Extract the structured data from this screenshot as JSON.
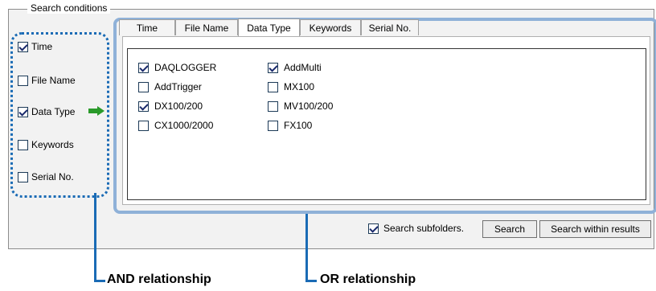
{
  "group": {
    "legend": "Search conditions"
  },
  "left_conditions": [
    {
      "label": "Time",
      "checked": true
    },
    {
      "label": "File Name",
      "checked": false
    },
    {
      "label": "Data Type",
      "checked": true
    },
    {
      "label": "Keywords",
      "checked": false
    },
    {
      "label": "Serial No.",
      "checked": false
    }
  ],
  "tabs": [
    {
      "label": "Time",
      "active": false
    },
    {
      "label": "File Name",
      "active": false
    },
    {
      "label": "Data Type",
      "active": true
    },
    {
      "label": "Keywords",
      "active": false
    },
    {
      "label": "Serial No.",
      "active": false
    }
  ],
  "data_types": {
    "left": [
      {
        "label": "DAQLOGGER",
        "checked": true
      },
      {
        "label": "AddTrigger",
        "checked": false
      },
      {
        "label": "DX100/200",
        "checked": true
      },
      {
        "label": "CX1000/2000",
        "checked": false
      }
    ],
    "right": [
      {
        "label": "AddMulti",
        "checked": true
      },
      {
        "label": "MX100",
        "checked": false
      },
      {
        "label": "MV100/200",
        "checked": false
      },
      {
        "label": "FX100",
        "checked": false
      }
    ]
  },
  "bottom": {
    "subfolders_label": "Search subfolders.",
    "subfolders_checked": true,
    "search_button": "Search",
    "search_within_button": "Search within results"
  },
  "annotations": {
    "and_label": "AND relationship",
    "or_label": "OR relationship"
  },
  "colors": {
    "and_border": "#1a6bb5",
    "or_border": "#8fb1d8",
    "arrow": "#2a9a2a"
  }
}
